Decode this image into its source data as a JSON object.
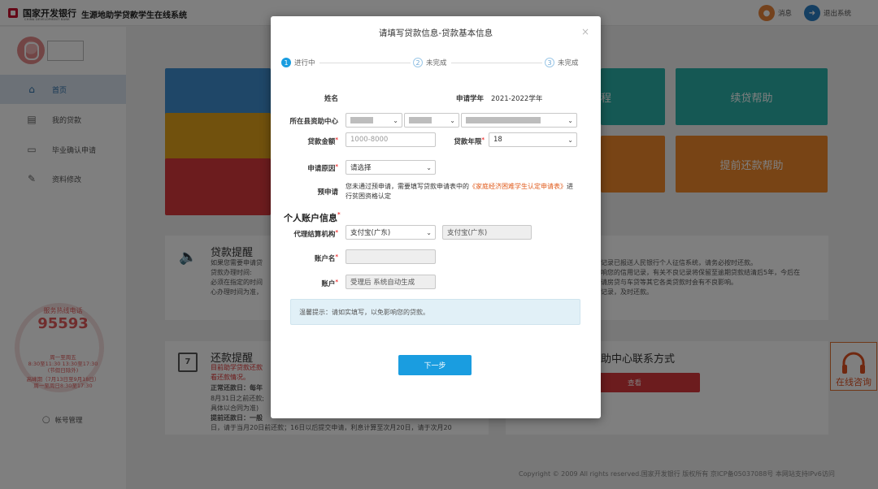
{
  "header": {
    "bank_name": "国家开发银行",
    "bank_name_en": "CHINA DEVELOPMENT BANK",
    "system_name": "生源地助学贷款学生在线系统",
    "messages_label": "消息",
    "logout_label": "退出系统"
  },
  "sidebar": {
    "items": [
      {
        "label": "首页",
        "icon": "home-icon"
      },
      {
        "label": "我的贷款",
        "icon": "document-icon"
      },
      {
        "label": "毕业确认申请",
        "icon": "inbox-icon"
      },
      {
        "label": "资料修改",
        "icon": "edit-icon"
      }
    ],
    "hotline_label": "服务热线电话",
    "hotline_number": "95593",
    "hotline_lines": [
      "周一至周五",
      "8:30至11:30 13:30至17:30",
      "(节假日除外)",
      "高峰期（7月13日至9月18日）",
      "周一至周日8:30至17:30"
    ],
    "account_mgmt": "帐号管理"
  },
  "background": {
    "tiles": [
      "续贷帮助",
      "提前还款帮助",
      "程"
    ],
    "loan_reminder_title": "贷款提醒",
    "loan_reminder_lines": [
      "如果您需要申请贷",
      "贷款办理时间:",
      "必须在指定的时间",
      "心办理时间为准，"
    ],
    "loan_reminder_right": [
      "记录已报送人民银行个人征信系统，请务必按时还款。",
      "响您的信用记录，有关不良记录将保留至逾期贷款结清后5年，今后在",
      "请房贷与车贷等其它各类贷款时会有不良影响。",
      "记录，及时还款。"
    ],
    "repay_reminder_title": "还款提醒",
    "repay_reminder_lines": [
      "目前助学贷款还款",
      "看还款情况。",
      "正常还款日：每年",
      "8月31日之前还款;",
      "具体以合同为准)",
      "提前还款日：一般",
      "日，请于当月20日前还款；16日以后提交申请，利息计算至次月20日，请于次月20"
    ],
    "contact_title": "助中心联系方式",
    "view_label": "查看",
    "footer": "Copyright © 2009 All rights reserved.国家开发银行 版权所有 京ICP备05037088号 本网站支持IPv6访问",
    "online_consult": "在线咨询"
  },
  "modal": {
    "title": "请填写贷款信息-贷款基本信息",
    "steps": [
      {
        "num": "1",
        "label": "进行中"
      },
      {
        "num": "2",
        "label": "未完成"
      },
      {
        "num": "3",
        "label": "未完成"
      }
    ],
    "name_label": "姓名",
    "year_label": "申请学年",
    "year_value": "2021-2022学年",
    "center_label": "所在县资助中心",
    "amount_label": "贷款金额",
    "amount_placeholder": "1000-8000",
    "term_label": "贷款年限",
    "term_value": "18",
    "reason_label": "申请原因",
    "reason_value": "请选择",
    "pre_label": "预申请",
    "pre_text_1": "您未通过预申请，需要填写贷款申请表中的",
    "pre_link": "《家庭经济困难学生认定申请表》",
    "pre_text_2": "进行贫困资格认定",
    "section_title": "个人账户信息",
    "agency_label": "代理结算机构",
    "agency_value": "支付宝(广东)",
    "agency_display": "支付宝(广东)",
    "account_name_label": "账户名",
    "account_label": "账户",
    "account_value": "受理后 系统自动生成",
    "tip": "温馨提示：请如实填写，以免影响您的贷款。",
    "next_label": "下一步",
    "close_label": "×"
  },
  "colors": {
    "primary": "#1a9de0",
    "teal": "#2ab0a8",
    "orange": "#f0882a",
    "red": "#d9383c",
    "blue": "#3f8fd0",
    "gold": "#e3a21a"
  }
}
